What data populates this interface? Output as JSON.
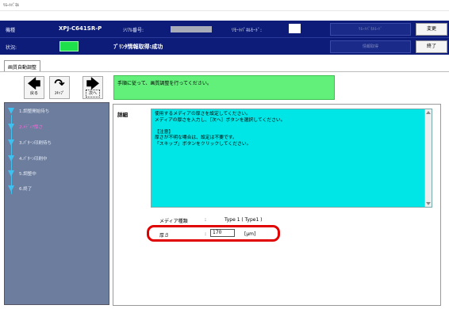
{
  "window": {
    "title": "ﾘﾓｰﾄﾊﾟﾈﾙ"
  },
  "header": {
    "model_label": "機種",
    "model_value": "XPJ-C641SR-P",
    "serial_label": "ｼﾘｱﾙ番号:",
    "remote_label": "ﾘﾓｰﾄﾊﾟﾈﾙﾓｰﾄﾞ:",
    "remote_mode_button": "ﾘﾓｰﾄﾊﾟﾈﾙﾓｰﾄﾞ",
    "change_button": "変更",
    "status_label": "状況:",
    "status_value": "ﾌﾟﾘﾝﾀ情報取得:成功",
    "info_button": "情報取得",
    "exit_button": "終了"
  },
  "tab": {
    "label": "画質自動調整"
  },
  "nav": {
    "back": "戻る",
    "skip": "ｽｷｯﾌﾟ",
    "next": "次へ"
  },
  "guide": {
    "text": "手順に従って、画質調整を行ってください。"
  },
  "steps": [
    {
      "label": "1.調整開始待ち"
    },
    {
      "label": "2.ﾒﾃﾞｨｱ厚さ"
    },
    {
      "label": "3.ﾊﾟﾀｰﾝ印刷待ち"
    },
    {
      "label": "4.ﾊﾟﾀｰﾝ印刷中"
    },
    {
      "label": "5.調整中"
    },
    {
      "label": "6.終了"
    }
  ],
  "detail": {
    "title": "詳細",
    "lines": [
      "使用するメディアの厚さを設定してください。",
      "メディアの厚さを入力し、［次へ］ボタンを選択してください。",
      "",
      "【注意】",
      "厚さが不明な場合は、設定は不要です。",
      "「スキップ」ボタンをクリックしてください。"
    ]
  },
  "media": {
    "label": "メディア種類",
    "colon": ":",
    "value": "Type 1 ( Type1 )"
  },
  "thickness": {
    "label": "厚さ",
    "colon": ":",
    "value": "170",
    "unit": "[μm]"
  },
  "colors": {
    "header_bg": "#0c1c78",
    "status_green": "#1de04a",
    "guide_green": "#62f07a",
    "detail_cyan": "#00e6e6",
    "sidebar_bg": "#6c7d9e",
    "step_marker": "#3ec0f0",
    "active_step": "#ff66dd",
    "highlight_ring": "#e00000"
  },
  "icons": {
    "back": "arrow-left-icon",
    "skip": "curved-arrow-icon",
    "next": "arrow-right-icon",
    "step": "triangle-down-icon"
  }
}
